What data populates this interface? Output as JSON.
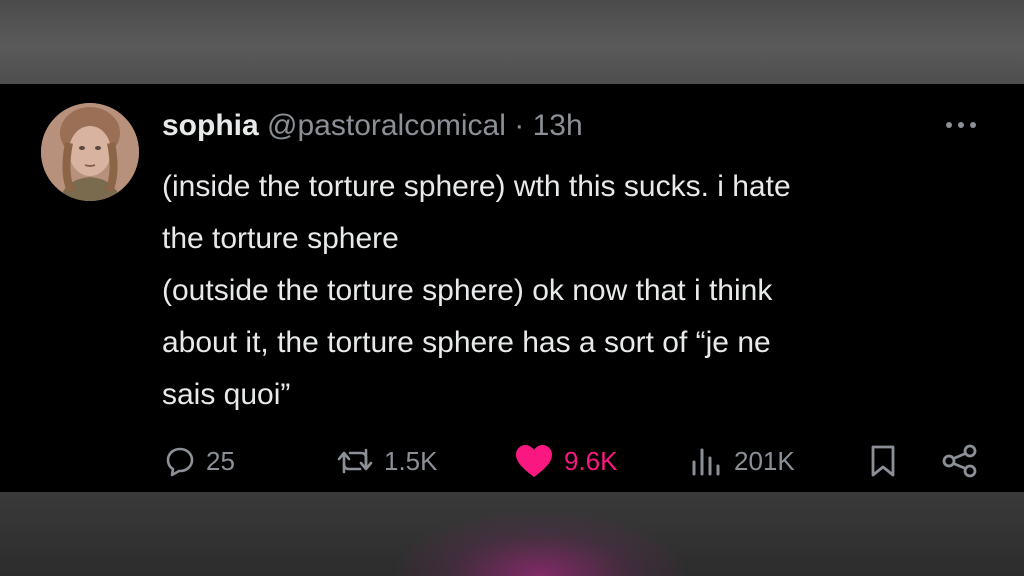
{
  "tweet": {
    "author": {
      "name": "sophia",
      "handle": "@pastoralcomical",
      "separator": "·",
      "time": "13h"
    },
    "body_lines": [
      "(inside the torture sphere) wth this sucks. i hate",
      "the torture sphere",
      "(outside the torture sphere) ok now that i think",
      "about it, the torture sphere has a sort of “je ne",
      "sais quoi”"
    ],
    "metrics": {
      "replies": "25",
      "reposts": "1.5K",
      "likes": "9.6K",
      "views": "201K"
    },
    "liked": true
  },
  "colors": {
    "background": "#000000",
    "text": "#e7e9ea",
    "secondary": "#8b9096",
    "like_pink": "#f91880"
  },
  "icons": [
    "more-icon",
    "reply-icon",
    "repost-icon",
    "like-icon",
    "views-icon",
    "bookmark-icon",
    "share-icon"
  ]
}
